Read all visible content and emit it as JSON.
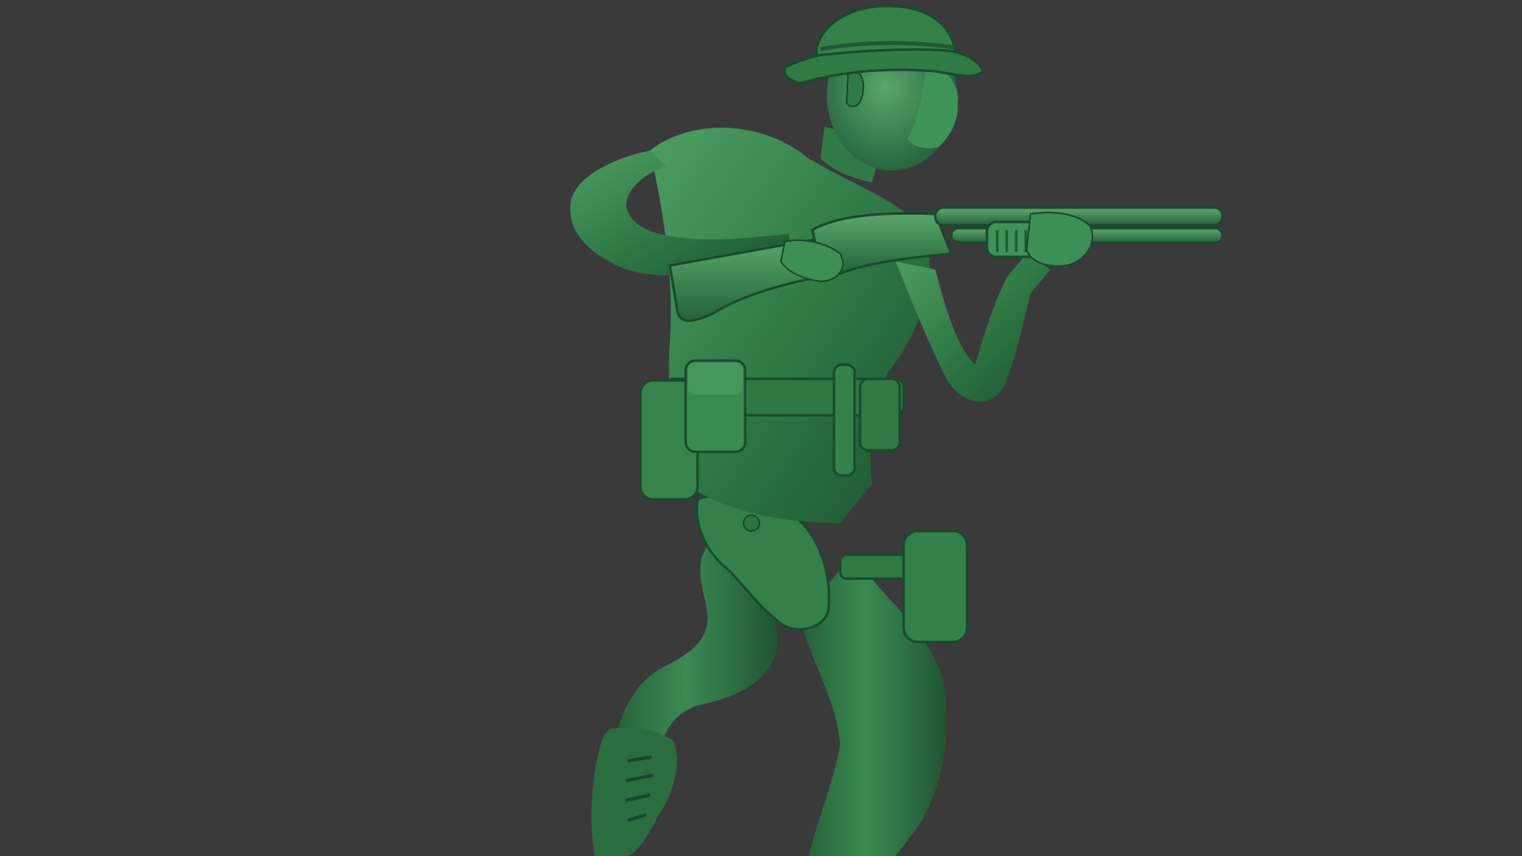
{
  "scene": {
    "background_color": "#3a3a3b",
    "model_color": "#2f7a45",
    "model_highlight": "#5fae72",
    "model_shadow": "#143d22",
    "subject": "green-army-soldier-figure-with-shotgun"
  }
}
